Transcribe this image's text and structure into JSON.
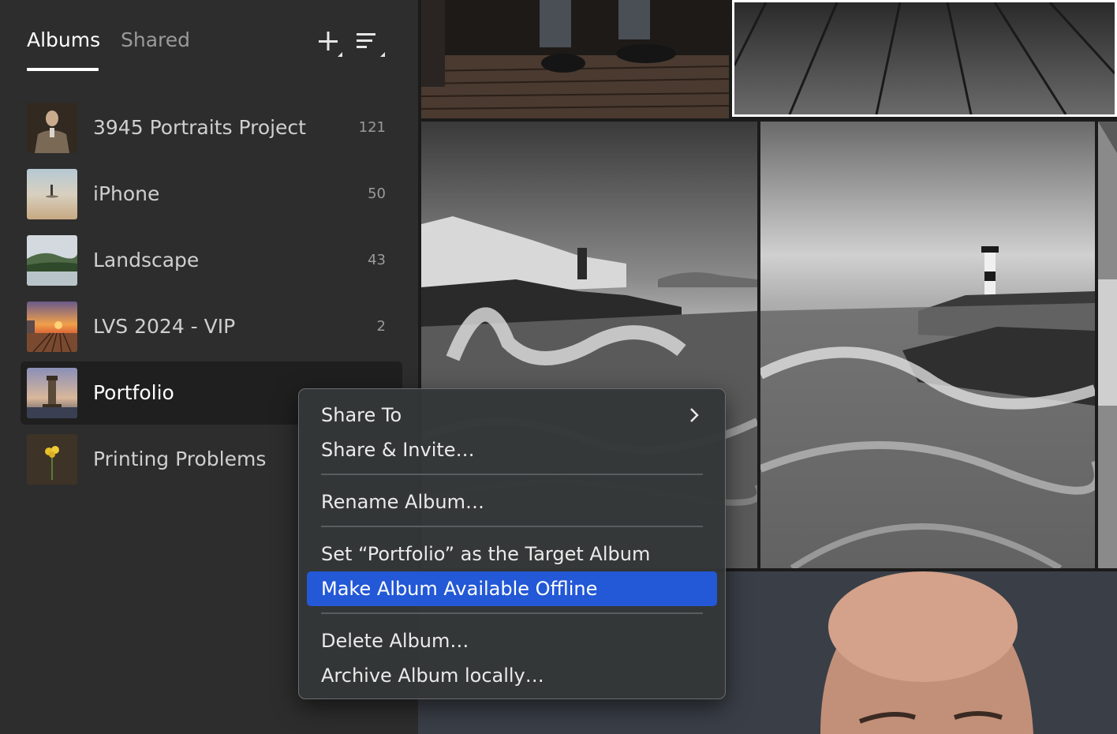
{
  "sidebar": {
    "tabs": [
      {
        "label": "Albums",
        "active": true
      },
      {
        "label": "Shared",
        "active": false
      }
    ],
    "tools": {
      "add_icon": "plus-icon",
      "sort_icon": "sort-lines-icon"
    },
    "albums": [
      {
        "name": "3945 Portraits Project",
        "count": "121",
        "thumb": "portrait-man"
      },
      {
        "name": "iPhone",
        "count": "50",
        "thumb": "beach-figure"
      },
      {
        "name": "Landscape",
        "count": "43",
        "thumb": "lake-hills"
      },
      {
        "name": "LVS 2024 - VIP",
        "count": "2",
        "thumb": "sunset-pier"
      },
      {
        "name": "Portfolio",
        "count": "",
        "thumb": "lighthouse",
        "selected": true
      },
      {
        "name": "Printing Problems",
        "count": "",
        "thumb": "yellow-flower"
      }
    ]
  },
  "context_menu": {
    "items": [
      {
        "label": "Share To",
        "submenu": true
      },
      {
        "label": "Share & Invite…"
      },
      {
        "label": "Rename Album…"
      },
      {
        "label": "Set “Portfolio” as the Target Album"
      },
      {
        "label": "Make Album Available Offline",
        "highlighted": true
      },
      {
        "label": "Delete Album…"
      },
      {
        "label": "Archive Album locally…"
      }
    ],
    "highlight_color": "#2358d6"
  },
  "photos": [
    {
      "subject": "feet-on-wooden-boardwalk"
    },
    {
      "subject": "wooden-planks"
    },
    {
      "subject": "stormy-harbor-waves"
    },
    {
      "subject": "lighthouse-rocky-coast"
    },
    {
      "subject": "partial-edge-photo"
    },
    {
      "subject": "bald-man-portrait"
    }
  ],
  "colors": {
    "sidebar_bg": "#2d2d2d",
    "selected_row": "#1f1f1f",
    "accent": "#2358d6"
  }
}
